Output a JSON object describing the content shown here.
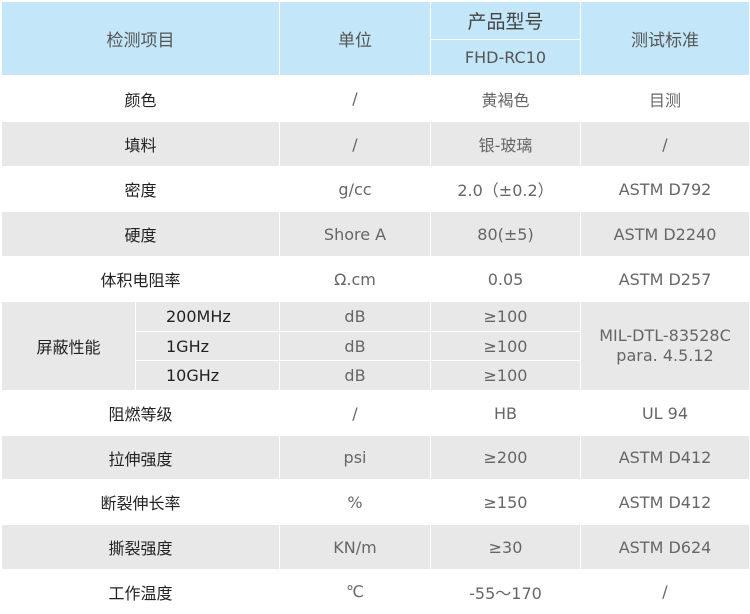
{
  "header": {
    "item": "检测项目",
    "unit": "单位",
    "model_title": "产品型号",
    "model": "FHD-RC10",
    "standard": "测试标准"
  },
  "rows": [
    {
      "item": "颜色",
      "unit": "/",
      "value": "黄褐色",
      "standard": "目测"
    },
    {
      "item": "填料",
      "unit": "/",
      "value": "银-玻璃",
      "standard": "/"
    },
    {
      "item": "密度",
      "unit": "g/cc",
      "value": "2.0（±0.2）",
      "standard": "ASTM D792"
    },
    {
      "item": "硬度",
      "unit": "Shore A",
      "value": "80(±5)",
      "standard": "ASTM D2240"
    },
    {
      "item": "体积电阻率",
      "unit": "Ω.cm",
      "value": "0.05",
      "standard": "ASTM D257"
    }
  ],
  "shielding": {
    "item": "屏蔽性能",
    "standard": "MIL-DTL-83528C para. 4.5.12",
    "subrows": [
      {
        "freq": "200MHz",
        "unit": "dB",
        "value": "≥100"
      },
      {
        "freq": "1GHz",
        "unit": "dB",
        "value": "≥100"
      },
      {
        "freq": "10GHz",
        "unit": "dB",
        "value": "≥100"
      }
    ]
  },
  "rows2": [
    {
      "item": "阻燃等级",
      "unit": "/",
      "value": "HB",
      "standard": "UL 94"
    },
    {
      "item": "拉伸强度",
      "unit": "psi",
      "value": "≥200",
      "standard": "ASTM D412"
    },
    {
      "item": "断裂伸长率",
      "unit": "%",
      "value": "≥150",
      "standard": "ASTM D412"
    },
    {
      "item": "撕裂强度",
      "unit": "KN/m",
      "value": "≥30",
      "standard": "ASTM D624"
    },
    {
      "item": "工作温度",
      "unit": "℃",
      "value": "-55～170",
      "standard": "/"
    }
  ]
}
